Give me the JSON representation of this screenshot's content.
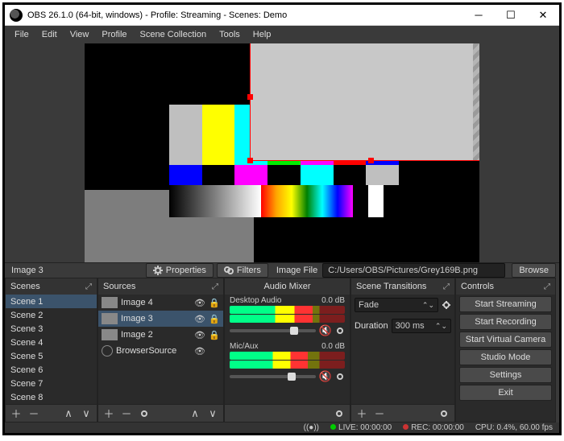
{
  "window": {
    "title": "OBS 26.1.0 (64-bit, windows) - Profile: Streaming - Scenes: Demo"
  },
  "menu": {
    "items": [
      "File",
      "Edit",
      "View",
      "Profile",
      "Scene Collection",
      "Tools",
      "Help"
    ]
  },
  "source_toolbar": {
    "selected": "Image 3",
    "properties": "Properties",
    "filters": "Filters",
    "path_label": "Image File",
    "path_value": "C:/Users/OBS/Pictures/Grey169B.png",
    "browse": "Browse"
  },
  "docks": {
    "scenes": {
      "title": "Scenes",
      "items": [
        "Scene 1",
        "Scene 2",
        "Scene 3",
        "Scene 4",
        "Scene 5",
        "Scene 6",
        "Scene 7",
        "Scene 8"
      ],
      "selected_index": 0
    },
    "sources": {
      "title": "Sources",
      "items": [
        {
          "label": "Image 4",
          "type": "image",
          "visible": true,
          "locked": true,
          "selected": false
        },
        {
          "label": "Image 3",
          "type": "image",
          "visible": true,
          "locked": true,
          "selected": true
        },
        {
          "label": "Image 2",
          "type": "image",
          "visible": true,
          "locked": true,
          "selected": false
        },
        {
          "label": "BrowserSource",
          "type": "browser",
          "visible": true,
          "locked": false,
          "selected": false
        }
      ]
    },
    "mixer": {
      "title": "Audio Mixer",
      "channels": [
        {
          "name": "Desktop Audio",
          "level": "0.0 dB",
          "level_pct": 72,
          "knob_pct": 70,
          "muted": true
        },
        {
          "name": "Mic/Aux",
          "level": "0.0 dB",
          "level_pct": 68,
          "knob_pct": 67,
          "muted": true
        }
      ]
    },
    "transitions": {
      "title": "Scene Transitions",
      "selected": "Fade",
      "duration_label": "Duration",
      "duration_value": "300 ms"
    },
    "controls": {
      "title": "Controls",
      "buttons": [
        "Start Streaming",
        "Start Recording",
        "Start Virtual Camera",
        "Studio Mode",
        "Settings",
        "Exit"
      ]
    }
  },
  "status": {
    "live_label": "LIVE:",
    "live_time": "00:00:00",
    "rec_label": "REC:",
    "rec_time": "00:00:00",
    "cpu": "CPU: 0.4%, 60.00 fps"
  }
}
